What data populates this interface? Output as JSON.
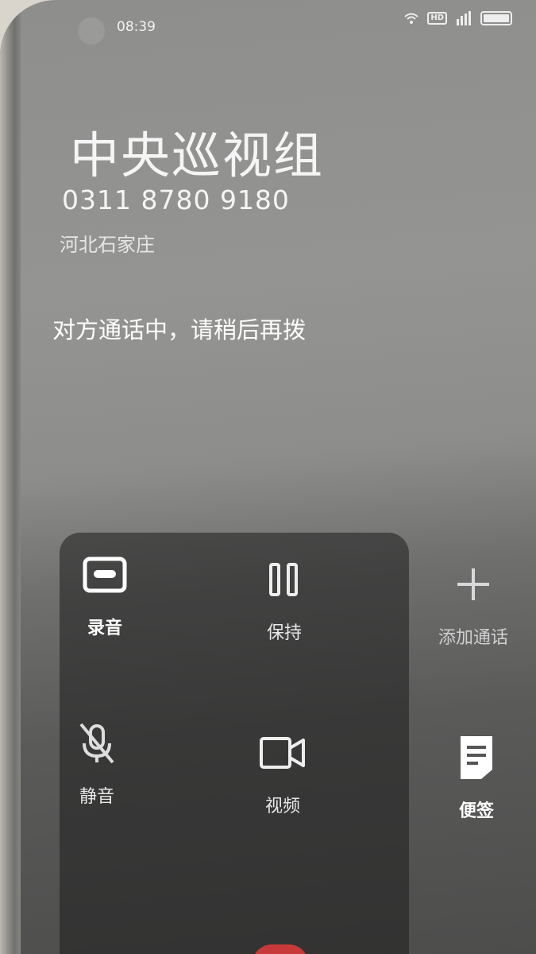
{
  "status_bar": {
    "time": "08:39",
    "icons": [
      "wifi-icon",
      "hd-icon",
      "signal-icon",
      "battery-icon"
    ],
    "hd_label": "HD"
  },
  "call": {
    "contact_name": "中央巡视组",
    "phone_number": "0311 8780 9180",
    "location": "河北石家庄",
    "status": "对方通话中，请稍后再拨"
  },
  "controls": [
    {
      "name": "record",
      "label": "录音",
      "icon": "cassette-icon"
    },
    {
      "name": "hold",
      "label": "保持",
      "icon": "pause-icon"
    },
    {
      "name": "add-call",
      "label": "添加通话",
      "icon": "plus-icon"
    },
    {
      "name": "mute",
      "label": "静音",
      "icon": "mic-off-icon"
    },
    {
      "name": "video",
      "label": "视频",
      "icon": "video-camera-icon"
    },
    {
      "name": "notes",
      "label": "便签",
      "icon": "note-icon"
    }
  ],
  "colors": {
    "text": "#f5f5f5",
    "end_call": "#c83a3a"
  }
}
